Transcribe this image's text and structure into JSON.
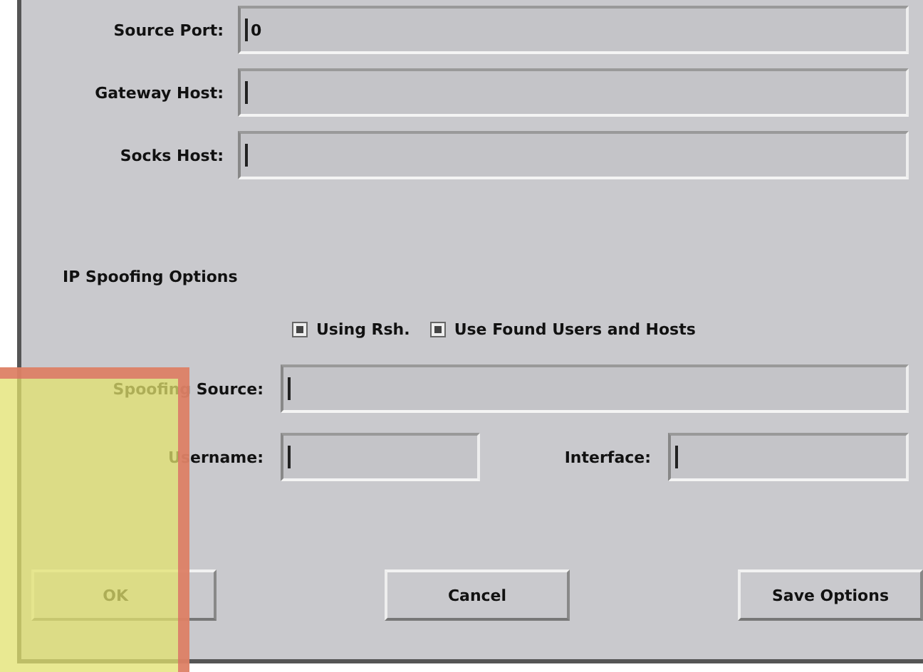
{
  "host_fields": [
    {
      "label": "Source Port:",
      "value": "0"
    },
    {
      "label": "Gateway Host:"
    },
    {
      "label": "Socks Host:"
    }
  ],
  "spoofing": {
    "title": "IP Spoofing Options",
    "checkboxes": [
      {
        "label": "Using Rsh.",
        "checked": true
      },
      {
        "label": "Use Found Users and Hosts",
        "checked": true
      }
    ],
    "source": {
      "label": "Spoofing Source:"
    },
    "username": {
      "label": "Username:"
    },
    "interface": {
      "label": "Interface:"
    }
  },
  "buttons": [
    {
      "label": "OK"
    },
    {
      "label": "Cancel"
    },
    {
      "label": "Save Options"
    }
  ]
}
